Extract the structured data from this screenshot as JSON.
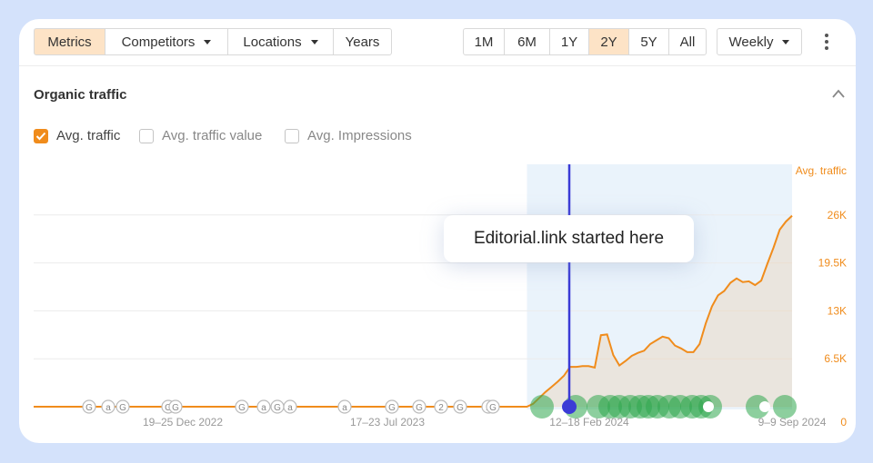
{
  "toolbar": {
    "tabs": [
      {
        "label": "Metrics",
        "active": true
      },
      {
        "label": "Competitors",
        "dropdown": true
      },
      {
        "label": "Locations",
        "dropdown": true
      },
      {
        "label": "Years"
      }
    ],
    "ranges": [
      {
        "label": "1M"
      },
      {
        "label": "6M"
      },
      {
        "label": "1Y"
      },
      {
        "label": "2Y",
        "active": true
      },
      {
        "label": "5Y"
      },
      {
        "label": "All"
      }
    ],
    "granularity": "Weekly",
    "more_icon": "kebab-menu-icon"
  },
  "section": {
    "title": "Organic traffic",
    "collapse_icon": "chevron-up-icon"
  },
  "legend": [
    {
      "label": "Avg. traffic",
      "checked": true
    },
    {
      "label": "Avg. traffic value",
      "checked": false
    },
    {
      "label": "Avg. Impressions",
      "checked": false
    }
  ],
  "callout": "Editorial.link started here",
  "colors": {
    "accent": "#f08c1c",
    "active_tab": "#fde3c6",
    "marker_line": "#3b3bd6",
    "highlight": "#eaf3fb",
    "event_green": "#2fa84f"
  },
  "chart_data": {
    "type": "area",
    "ylabel": "Avg. traffic",
    "ylim": [
      0,
      32500
    ],
    "y_ticks": [
      "0",
      "6.5K",
      "13K",
      "19.5K",
      "26K"
    ],
    "x_ticks": [
      "19–25 Dec 2022",
      "17–23 Jul 2023",
      "12–18 Feb 2024",
      "9–9 Sep 2024"
    ],
    "grid": true,
    "start_marker": "12–18 Feb 2024",
    "series": [
      {
        "values": [
          0,
          0,
          0,
          0,
          0,
          0,
          0,
          0,
          0,
          0,
          0,
          0,
          0,
          0,
          0,
          0,
          0,
          0,
          0,
          0,
          0,
          0,
          0,
          0,
          0,
          0,
          0,
          0,
          0,
          0,
          0,
          0,
          0,
          0,
          0,
          0,
          0,
          0,
          0,
          0,
          0,
          0,
          0,
          0,
          0,
          0,
          0,
          0,
          0,
          0,
          0,
          0,
          0,
          0,
          0,
          0,
          0,
          0,
          0,
          0,
          0,
          0,
          0,
          0,
          0,
          0,
          0,
          0,
          0,
          0,
          0,
          0,
          0,
          0,
          0,
          0,
          0,
          0,
          0,
          0,
          0,
          400,
          1200,
          2000,
          2700,
          3400,
          4200,
          5400,
          5400,
          5500,
          5500,
          5300,
          9700,
          9800,
          7000,
          5600,
          6200,
          6900,
          7300,
          7600,
          8500,
          9000,
          9500,
          9300,
          8300,
          7900,
          7400,
          7400,
          8500,
          11300,
          13600,
          15100,
          15700,
          16800,
          17400,
          16900,
          17000,
          16500,
          17100,
          19400,
          21600,
          24000,
          25100,
          25900
        ]
      }
    ],
    "events": {
      "text_markers": [
        "<G",
        "a",
        "G",
        "<G",
        "G",
        "G",
        "a",
        "G",
        "a",
        "a",
        "G",
        "G",
        "2",
        "<G",
        "2",
        "G"
      ],
      "updates_after_start": 22
    }
  }
}
